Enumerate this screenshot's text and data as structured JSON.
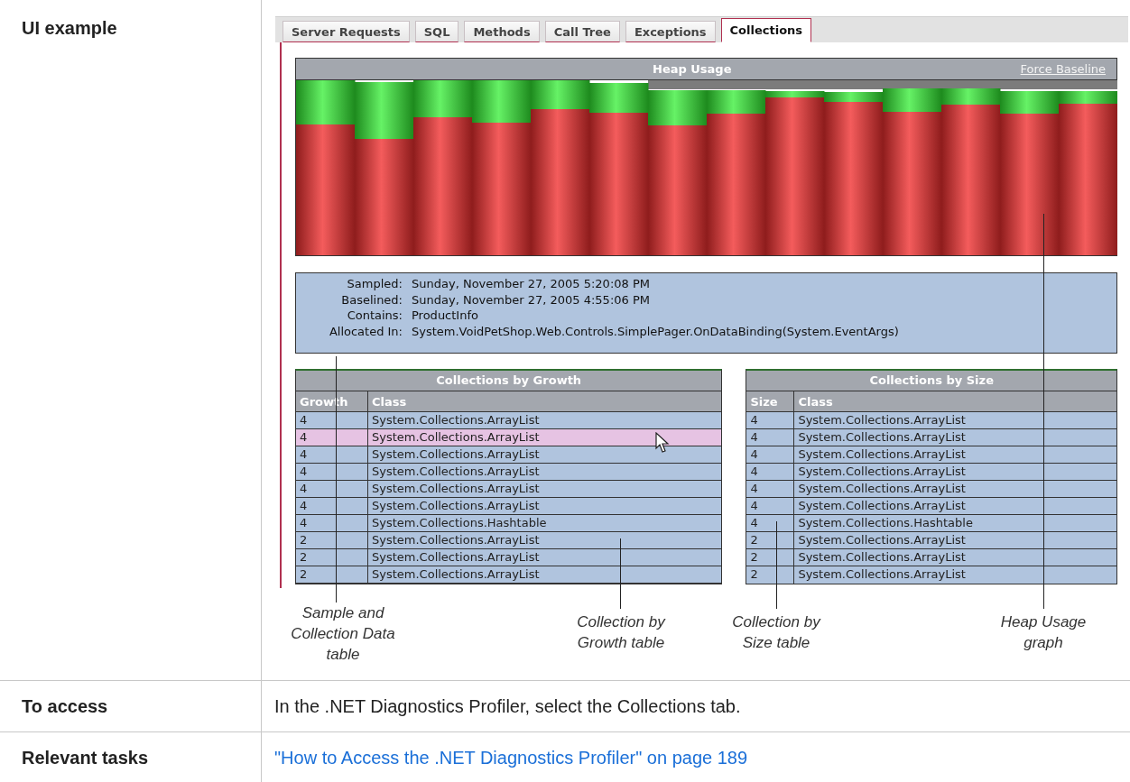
{
  "ui_example": {
    "label": "UI example"
  },
  "tabs": [
    {
      "label": "Server Requests",
      "selected": false
    },
    {
      "label": "SQL",
      "selected": false
    },
    {
      "label": "Methods",
      "selected": false
    },
    {
      "label": "Call Tree",
      "selected": false
    },
    {
      "label": "Exceptions",
      "selected": false
    },
    {
      "label": "Collections",
      "selected": true
    }
  ],
  "heap_usage": {
    "title": "Heap Usage",
    "link": "Force Baseline"
  },
  "sample_info": [
    {
      "label": "Sampled:",
      "value": "Sunday, November 27, 2005 5:20:08 PM"
    },
    {
      "label": "Baselined:",
      "value": "Sunday, November 27, 2005 4:55:06 PM"
    },
    {
      "label": "Contains:",
      "value": "ProductInfo"
    },
    {
      "label": "Allocated In:",
      "value": "System.VoidPetShop.Web.Controls.SimplePager.OnDataBinding(System.EventArgs)"
    }
  ],
  "growth_table": {
    "title": "Collections by Growth",
    "columns": [
      "Growth",
      "Class"
    ],
    "rows": [
      {
        "cells": [
          "4",
          "System.Collections.ArrayList"
        ],
        "selected": false
      },
      {
        "cells": [
          "4",
          "System.Collections.ArrayList"
        ],
        "selected": true
      },
      {
        "cells": [
          "4",
          "System.Collections.ArrayList"
        ],
        "selected": false
      },
      {
        "cells": [
          "4",
          "System.Collections.ArrayList"
        ],
        "selected": false
      },
      {
        "cells": [
          "4",
          "System.Collections.ArrayList"
        ],
        "selected": false
      },
      {
        "cells": [
          "4",
          "System.Collections.ArrayList"
        ],
        "selected": false
      },
      {
        "cells": [
          "4",
          "System.Collections.Hashtable"
        ],
        "selected": false
      },
      {
        "cells": [
          "2",
          "System.Collections.ArrayList"
        ],
        "selected": false
      },
      {
        "cells": [
          "2",
          "System.Collections.ArrayList"
        ],
        "selected": false
      },
      {
        "cells": [
          "2",
          "System.Collections.ArrayList"
        ],
        "selected": false
      }
    ]
  },
  "size_table": {
    "title": "Collections by Size",
    "columns": [
      "Size",
      "Class"
    ],
    "rows": [
      {
        "cells": [
          "4",
          "System.Collections.ArrayList"
        ],
        "selected": false
      },
      {
        "cells": [
          "4",
          "System.Collections.ArrayList"
        ],
        "selected": false
      },
      {
        "cells": [
          "4",
          "System.Collections.ArrayList"
        ],
        "selected": false
      },
      {
        "cells": [
          "4",
          "System.Collections.ArrayList"
        ],
        "selected": false
      },
      {
        "cells": [
          "4",
          "System.Collections.ArrayList"
        ],
        "selected": false
      },
      {
        "cells": [
          "4",
          "System.Collections.ArrayList"
        ],
        "selected": false
      },
      {
        "cells": [
          "4",
          "System.Collections.Hashtable"
        ],
        "selected": false
      },
      {
        "cells": [
          "2",
          "System.Collections.ArrayList"
        ],
        "selected": false
      },
      {
        "cells": [
          "2",
          "System.Collections.ArrayList"
        ],
        "selected": false
      },
      {
        "cells": [
          "2",
          "System.Collections.ArrayList"
        ],
        "selected": false
      }
    ]
  },
  "callouts": [
    "Sample and Collection Data table",
    "Collection by Growth table",
    "Collection by Size table",
    "Heap Usage graph"
  ],
  "access": {
    "label": "To access",
    "text": "In the .NET Diagnostics Profiler, select the Collections tab."
  },
  "tasks": {
    "label": "Relevant tasks",
    "link": "\"How to Access the .NET Diagnostics Profiler\" on page 189"
  }
}
